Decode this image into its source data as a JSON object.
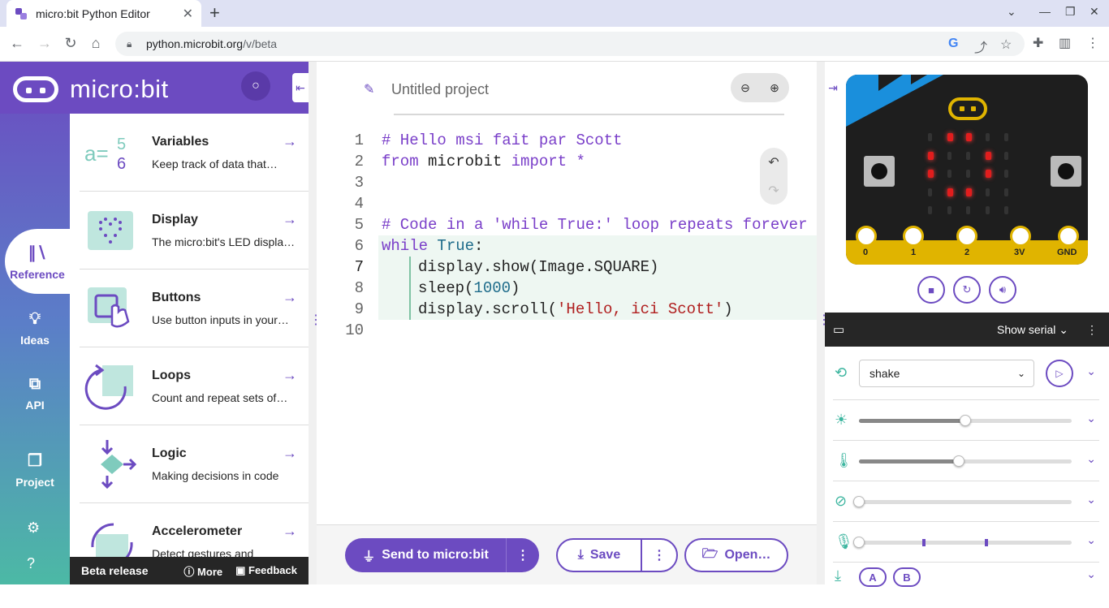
{
  "browser": {
    "tab_title": "micro:bit Python Editor",
    "url_host": "python.microbit.org",
    "url_path": "/v/beta"
  },
  "app": {
    "brand": "micro:bit",
    "nav": {
      "reference": "Reference",
      "ideas": "Ideas",
      "api": "API",
      "project": "Project"
    },
    "reference_items": [
      {
        "title": "Variables",
        "desc": "Keep track of data that…"
      },
      {
        "title": "Display",
        "desc": "The micro:bit's LED displa…"
      },
      {
        "title": "Buttons",
        "desc": "Use button inputs in your…"
      },
      {
        "title": "Loops",
        "desc": "Count and repeat sets of…"
      },
      {
        "title": "Logic",
        "desc": "Making decisions in code"
      },
      {
        "title": "Accelerometer",
        "desc": "Detect gestures and"
      }
    ],
    "beta": {
      "label": "Beta release",
      "more": "More",
      "feedback": "Feedback"
    }
  },
  "editor": {
    "project_placeholder": "Untitled project",
    "code_lines": [
      {
        "num": "1",
        "text": "# Hello msi fait par Scott"
      },
      {
        "num": "2",
        "text": "from microbit import *"
      },
      {
        "num": "3",
        "text": ""
      },
      {
        "num": "4",
        "text": ""
      },
      {
        "num": "5",
        "text": "# Code in a 'while True:' loop repeats forever"
      },
      {
        "num": "6",
        "text": "while True:"
      },
      {
        "num": "7",
        "text": "display.show(Image.SQUARE)"
      },
      {
        "num": "8",
        "text": "sleep(1000)"
      },
      {
        "num": "9",
        "text": "display.scroll('Hello, ici Scott')"
      },
      {
        "num": "10",
        "text": ""
      }
    ],
    "send_label": "Send to micro:bit",
    "save_label": "Save",
    "open_label": "Open…"
  },
  "simulator": {
    "pins": [
      "0",
      "1",
      "2",
      "3V",
      "GND"
    ],
    "serial_label": "Show serial",
    "gesture": "shake",
    "light_level": 0.5,
    "temperature_level": 0.47,
    "compass_level": 0.0,
    "sound_level": 0.0,
    "button_a": "A",
    "button_b": "B"
  },
  "colors": {
    "brand": "#6c4bc1",
    "teal": "#3eb6a0",
    "led_on": "#e21d1d",
    "gold": "#e0b400"
  }
}
